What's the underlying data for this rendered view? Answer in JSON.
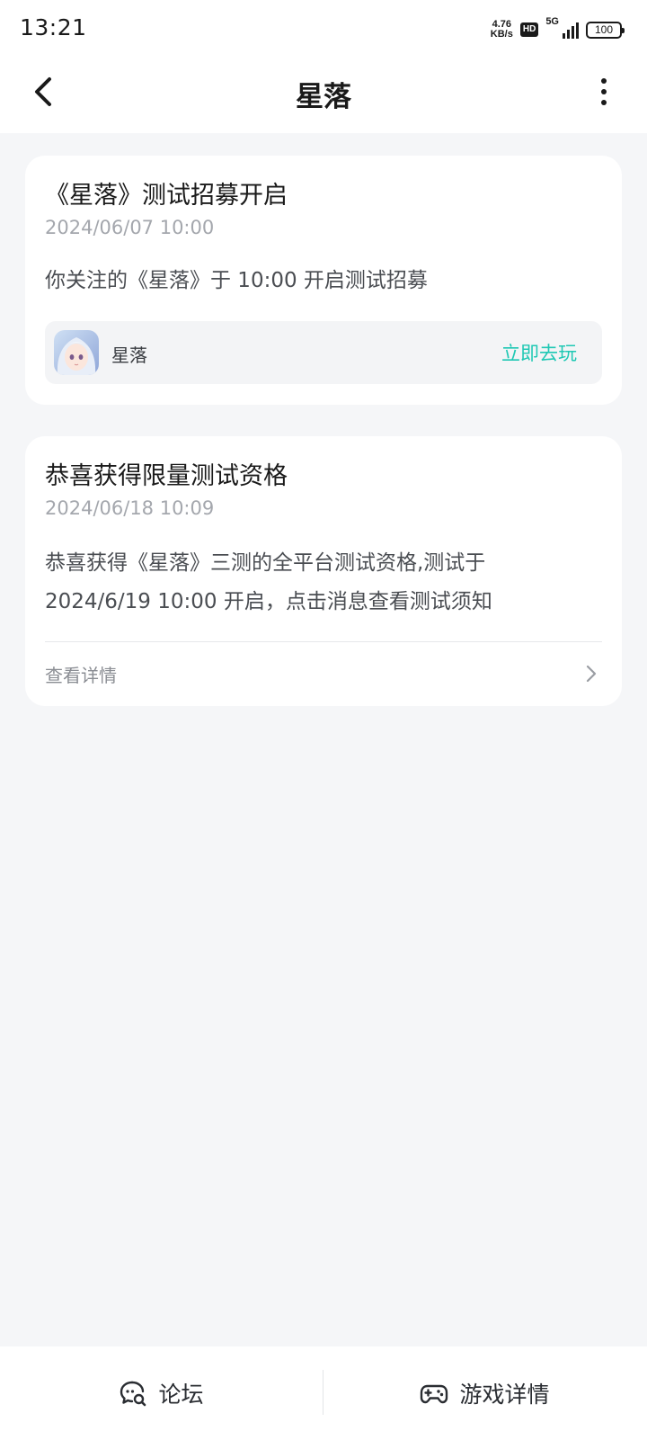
{
  "status_bar": {
    "time": "13:21",
    "net_speed_value": "4.76",
    "net_speed_unit": "KB/s",
    "hd_badge": "HD",
    "network_type": "5G",
    "battery": "100"
  },
  "header": {
    "title": "星落",
    "back_icon": "chevron-left-icon",
    "more_icon": "more-vertical-icon"
  },
  "cards": [
    {
      "title": "《星落》测试招募开启",
      "time": "2024/06/07 10:00",
      "body": "你关注的《星落》于 10:00 开启测试招募",
      "game": {
        "name": "星落",
        "action": "立即去玩"
      }
    },
    {
      "title": "恭喜获得限量测试资格",
      "time": "2024/06/18 10:09",
      "body_line1": "恭喜获得《星落》三测的全平台测试资格,测试于",
      "body_line2": "2024/6/19 10:00 开启，点击消息查看测试须知",
      "detail_label": "查看详情"
    }
  ],
  "bottom_bar": {
    "forum_label": "论坛",
    "forum_icon": "chat-search-icon",
    "game_detail_label": "游戏详情",
    "game_detail_icon": "gamepad-icon"
  },
  "colors": {
    "accent": "#1fc8b4",
    "background": "#f5f6f8",
    "card": "#ffffff"
  }
}
